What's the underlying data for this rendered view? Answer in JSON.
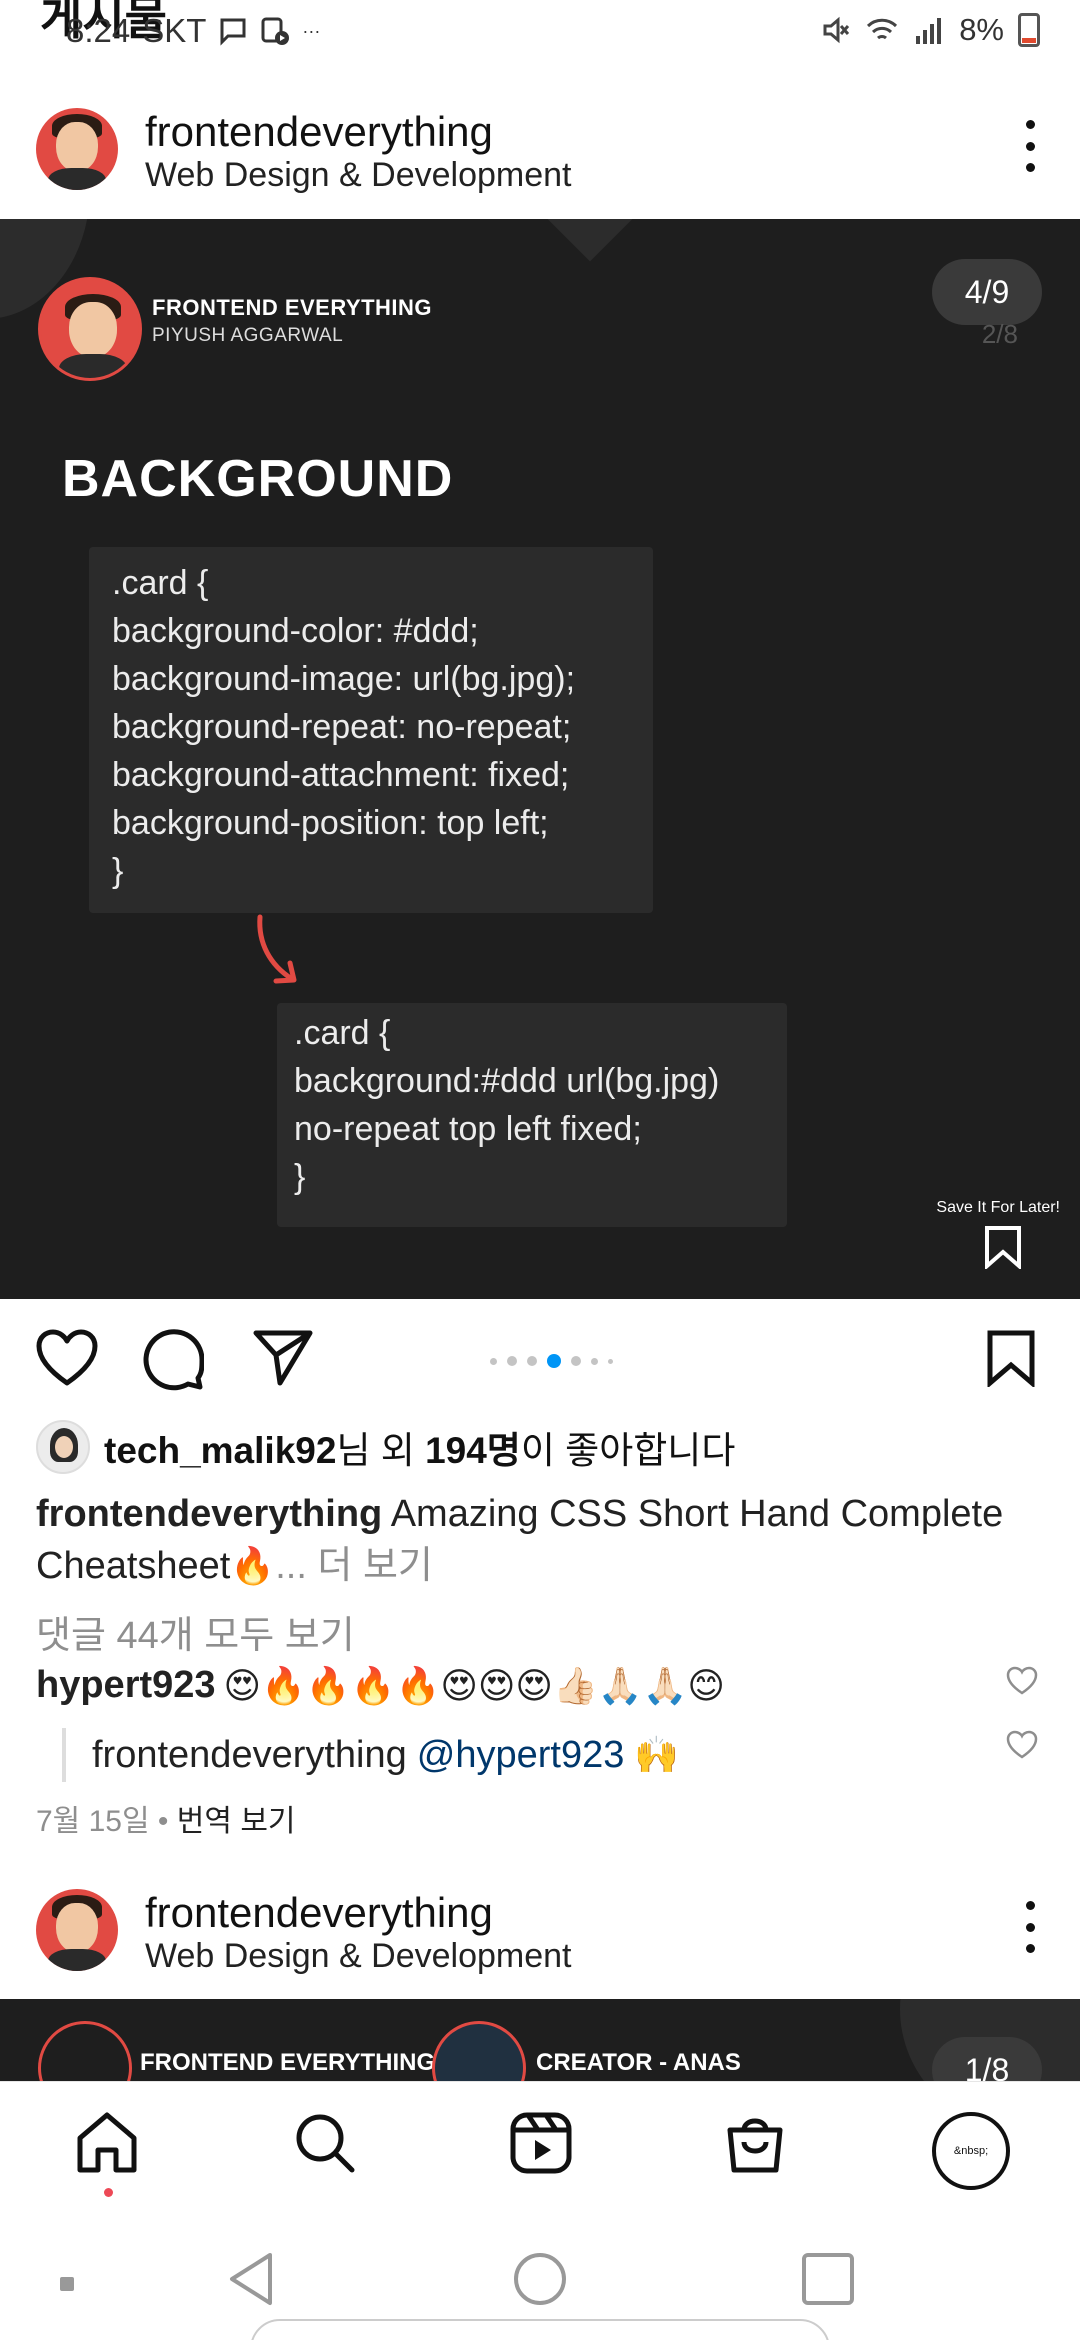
{
  "status_bar": {
    "time": "8:24",
    "carrier": "SKT",
    "dots": "···",
    "battery": "8%"
  },
  "top_partial_title": "게시물",
  "post1": {
    "username": "frontendeverything",
    "subtitle": "Web Design & Development",
    "image": {
      "brand": "FRONTEND EVERYTHING",
      "author": "PIYUSH AGGARWAL",
      "counter": "4/9",
      "counter_ghost": "2/8",
      "section_title": "BACKGROUND",
      "code_long": [
        ".card {",
        "background-color: #ddd;",
        "background-image: url(bg.jpg);",
        "background-repeat: no-repeat;",
        "background-attachment: fixed;",
        "background-position: top left;",
        "}"
      ],
      "code_short": [
        ".card {",
        "background:#ddd url(bg.jpg)",
        "no-repeat top left fixed;",
        "}"
      ],
      "save_later": "Save It For Later!"
    },
    "carousel_position": "4/9",
    "likes": {
      "user": "tech_malik92",
      "middle": "님 외 ",
      "count": "194명",
      "end": "이 좋아합니다"
    },
    "caption": {
      "user": "frontendeverything",
      "text": " Amazing CSS Short Hand Complete Cheatsheet",
      "emoji": "🔥",
      "more": "... 더 보기"
    },
    "view_comments": "댓글 44개 모두 보기",
    "comment": {
      "user": "hypert923",
      "emojis": "😍🔥🔥🔥🔥😍😍😍👍🏻🙏🏻🙏🏻😊"
    },
    "reply": {
      "user": "frontendeverything",
      "mention": "@hypert923",
      "emoji": "🙌"
    },
    "meta": {
      "date": "7월 15일",
      "separator": " • ",
      "translate": "번역 보기"
    }
  },
  "post2": {
    "username": "frontendeverything",
    "subtitle": "Web Design & Development",
    "brand": "FRONTEND EVERYTHING",
    "creator": "CREATOR - ANAS",
    "counter": "1/8"
  },
  "bottom_nav": {
    "profile_text": "&nbsp;"
  },
  "colors": {
    "image_bg": "#1e1e1e",
    "accent_red": "#e14a43",
    "carousel_active": "#0095f6",
    "muted": "#8e8e8e",
    "mention": "#00376b"
  }
}
